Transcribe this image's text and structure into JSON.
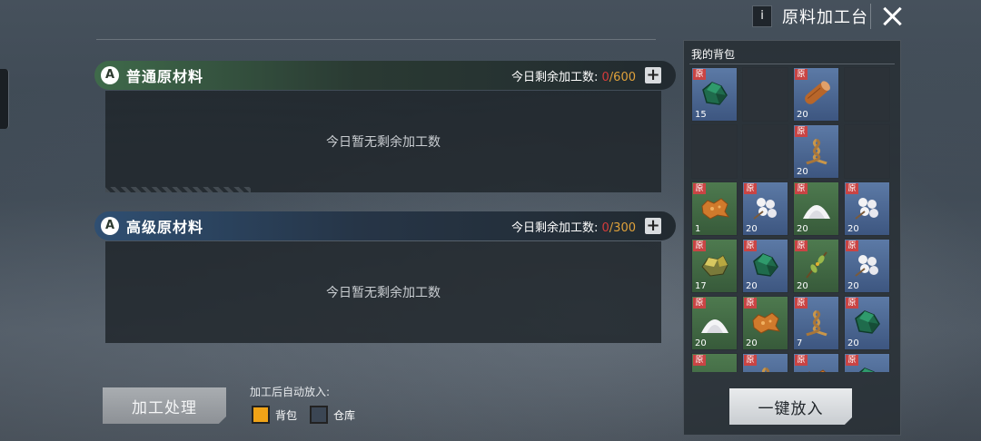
{
  "header": {
    "info_glyph": "i",
    "title": "原料加工台"
  },
  "sections": [
    {
      "title": "普通原材料",
      "icon_glyph": "A",
      "remain_label": "今日剩余加工数:",
      "remain_current": "0",
      "remain_sep": "/",
      "remain_max": "600",
      "empty_text": "今日暂无剩余加工数",
      "accent": "#3f6a4a"
    },
    {
      "title": "高级原材料",
      "icon_glyph": "A",
      "remain_label": "今日剩余加工数:",
      "remain_current": "0",
      "remain_sep": "/",
      "remain_max": "300",
      "empty_text": "今日暂无剩余加工数",
      "accent": "#2f4f72"
    }
  ],
  "controls": {
    "process_button": "加工处理",
    "auto_label": "加工后自动放入:",
    "option_bag": "背包",
    "option_warehouse": "仓库",
    "bag_checked": true,
    "warehouse_checked": false
  },
  "backpack": {
    "title": "我的背包",
    "badge": "原",
    "put_all_button": "一键放入",
    "items": [
      {
        "icon": "green-ore-icon",
        "qty": "15",
        "bg": "blue"
      },
      {
        "icon": "",
        "qty": "",
        "bg": "empty"
      },
      {
        "icon": "wood-log-icon",
        "qty": "20",
        "bg": "blue"
      },
      {
        "icon": "",
        "qty": "",
        "bg": "empty"
      },
      {
        "icon": "",
        "qty": "",
        "bg": "empty"
      },
      {
        "icon": "",
        "qty": "",
        "bg": "empty"
      },
      {
        "icon": "rope-icon",
        "qty": "20",
        "bg": "blue"
      },
      {
        "icon": "",
        "qty": "",
        "bg": "empty"
      },
      {
        "icon": "leather-icon",
        "qty": "1",
        "bg": "green"
      },
      {
        "icon": "cotton-icon",
        "qty": "20",
        "bg": "blue"
      },
      {
        "icon": "salt-pile-icon",
        "qty": "20",
        "bg": "green"
      },
      {
        "icon": "cotton-icon",
        "qty": "20",
        "bg": "blue"
      },
      {
        "icon": "gold-ore-icon",
        "qty": "17",
        "bg": "green"
      },
      {
        "icon": "green-ore-icon",
        "qty": "20",
        "bg": "blue"
      },
      {
        "icon": "herb-branch-icon",
        "qty": "20",
        "bg": "green"
      },
      {
        "icon": "cotton-icon",
        "qty": "20",
        "bg": "blue"
      },
      {
        "icon": "salt-pile-icon",
        "qty": "20",
        "bg": "green"
      },
      {
        "icon": "leather-icon",
        "qty": "20",
        "bg": "green"
      },
      {
        "icon": "rope-icon",
        "qty": "7",
        "bg": "blue"
      },
      {
        "icon": "green-ore-icon",
        "qty": "20",
        "bg": "blue"
      },
      {
        "icon": "salt-pile-icon",
        "qty": "",
        "bg": "green"
      },
      {
        "icon": "rope-icon",
        "qty": "",
        "bg": "blue"
      },
      {
        "icon": "leather-icon",
        "qty": "",
        "bg": "blue"
      },
      {
        "icon": "green-ore-icon",
        "qty": "",
        "bg": "blue"
      }
    ]
  }
}
